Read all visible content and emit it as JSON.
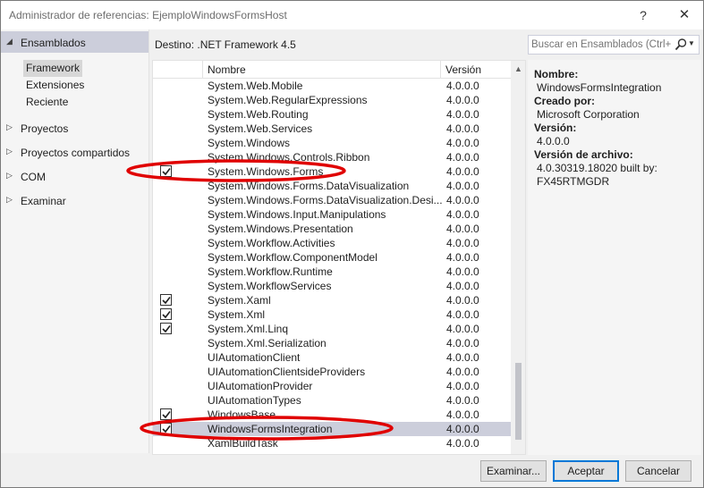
{
  "window": {
    "title": "Administrador de referencias: EjemploWindowsFormsHost",
    "help_glyph": "?",
    "close_glyph": "✕"
  },
  "nav": {
    "assemblies": "Ensamblados",
    "assemblies_sub": [
      "Framework",
      "Extensiones",
      "Reciente"
    ],
    "others": [
      "Proyectos",
      "Proyectos compartidos",
      "COM",
      "Examinar"
    ]
  },
  "target_label": "Destino: .NET Framework 4.5",
  "search": {
    "placeholder": "Buscar en Ensamblados (Ctrl+E)",
    "icon": "search-icon"
  },
  "list": {
    "columns": {
      "name": "Nombre",
      "version": "Versión"
    },
    "rows": [
      {
        "name": "System.Web.Mobile",
        "version": "4.0.0.0",
        "checked": false
      },
      {
        "name": "System.Web.RegularExpressions",
        "version": "4.0.0.0",
        "checked": false
      },
      {
        "name": "System.Web.Routing",
        "version": "4.0.0.0",
        "checked": false
      },
      {
        "name": "System.Web.Services",
        "version": "4.0.0.0",
        "checked": false
      },
      {
        "name": "System.Windows",
        "version": "4.0.0.0",
        "checked": false
      },
      {
        "name": "System.Windows.Controls.Ribbon",
        "version": "4.0.0.0",
        "checked": false
      },
      {
        "name": "System.Windows.Forms",
        "version": "4.0.0.0",
        "checked": true
      },
      {
        "name": "System.Windows.Forms.DataVisualization",
        "version": "4.0.0.0",
        "checked": false
      },
      {
        "name": "System.Windows.Forms.DataVisualization.Desi...",
        "version": "4.0.0.0",
        "checked": false
      },
      {
        "name": "System.Windows.Input.Manipulations",
        "version": "4.0.0.0",
        "checked": false
      },
      {
        "name": "System.Windows.Presentation",
        "version": "4.0.0.0",
        "checked": false
      },
      {
        "name": "System.Workflow.Activities",
        "version": "4.0.0.0",
        "checked": false
      },
      {
        "name": "System.Workflow.ComponentModel",
        "version": "4.0.0.0",
        "checked": false
      },
      {
        "name": "System.Workflow.Runtime",
        "version": "4.0.0.0",
        "checked": false
      },
      {
        "name": "System.WorkflowServices",
        "version": "4.0.0.0",
        "checked": false
      },
      {
        "name": "System.Xaml",
        "version": "4.0.0.0",
        "checked": true
      },
      {
        "name": "System.Xml",
        "version": "4.0.0.0",
        "checked": true
      },
      {
        "name": "System.Xml.Linq",
        "version": "4.0.0.0",
        "checked": true
      },
      {
        "name": "System.Xml.Serialization",
        "version": "4.0.0.0",
        "checked": false
      },
      {
        "name": "UIAutomationClient",
        "version": "4.0.0.0",
        "checked": false
      },
      {
        "name": "UIAutomationClientsideProviders",
        "version": "4.0.0.0",
        "checked": false
      },
      {
        "name": "UIAutomationProvider",
        "version": "4.0.0.0",
        "checked": false
      },
      {
        "name": "UIAutomationTypes",
        "version": "4.0.0.0",
        "checked": false
      },
      {
        "name": "WindowsBase",
        "version": "4.0.0.0",
        "checked": true
      },
      {
        "name": "WindowsFormsIntegration",
        "version": "4.0.0.0",
        "checked": true,
        "selected": true
      },
      {
        "name": "XamlBuildTask",
        "version": "4.0.0.0",
        "checked": false
      }
    ]
  },
  "details": {
    "name_label": "Nombre:",
    "name_value": "WindowsFormsIntegration",
    "author_label": "Creado por:",
    "author_value": "Microsoft Corporation",
    "version_label": "Versión:",
    "version_value": "4.0.0.0",
    "file_version_label": "Versión de archivo:",
    "file_version_line1": "4.0.30319.18020 built by:",
    "file_version_line2": "FX45RTMGDR"
  },
  "buttons": {
    "browse": "Examinar...",
    "ok": "Aceptar",
    "cancel": "Cancelar"
  },
  "colors": {
    "selection": "#cccedb",
    "annotation": "#e00000",
    "accent": "#0078d7"
  }
}
